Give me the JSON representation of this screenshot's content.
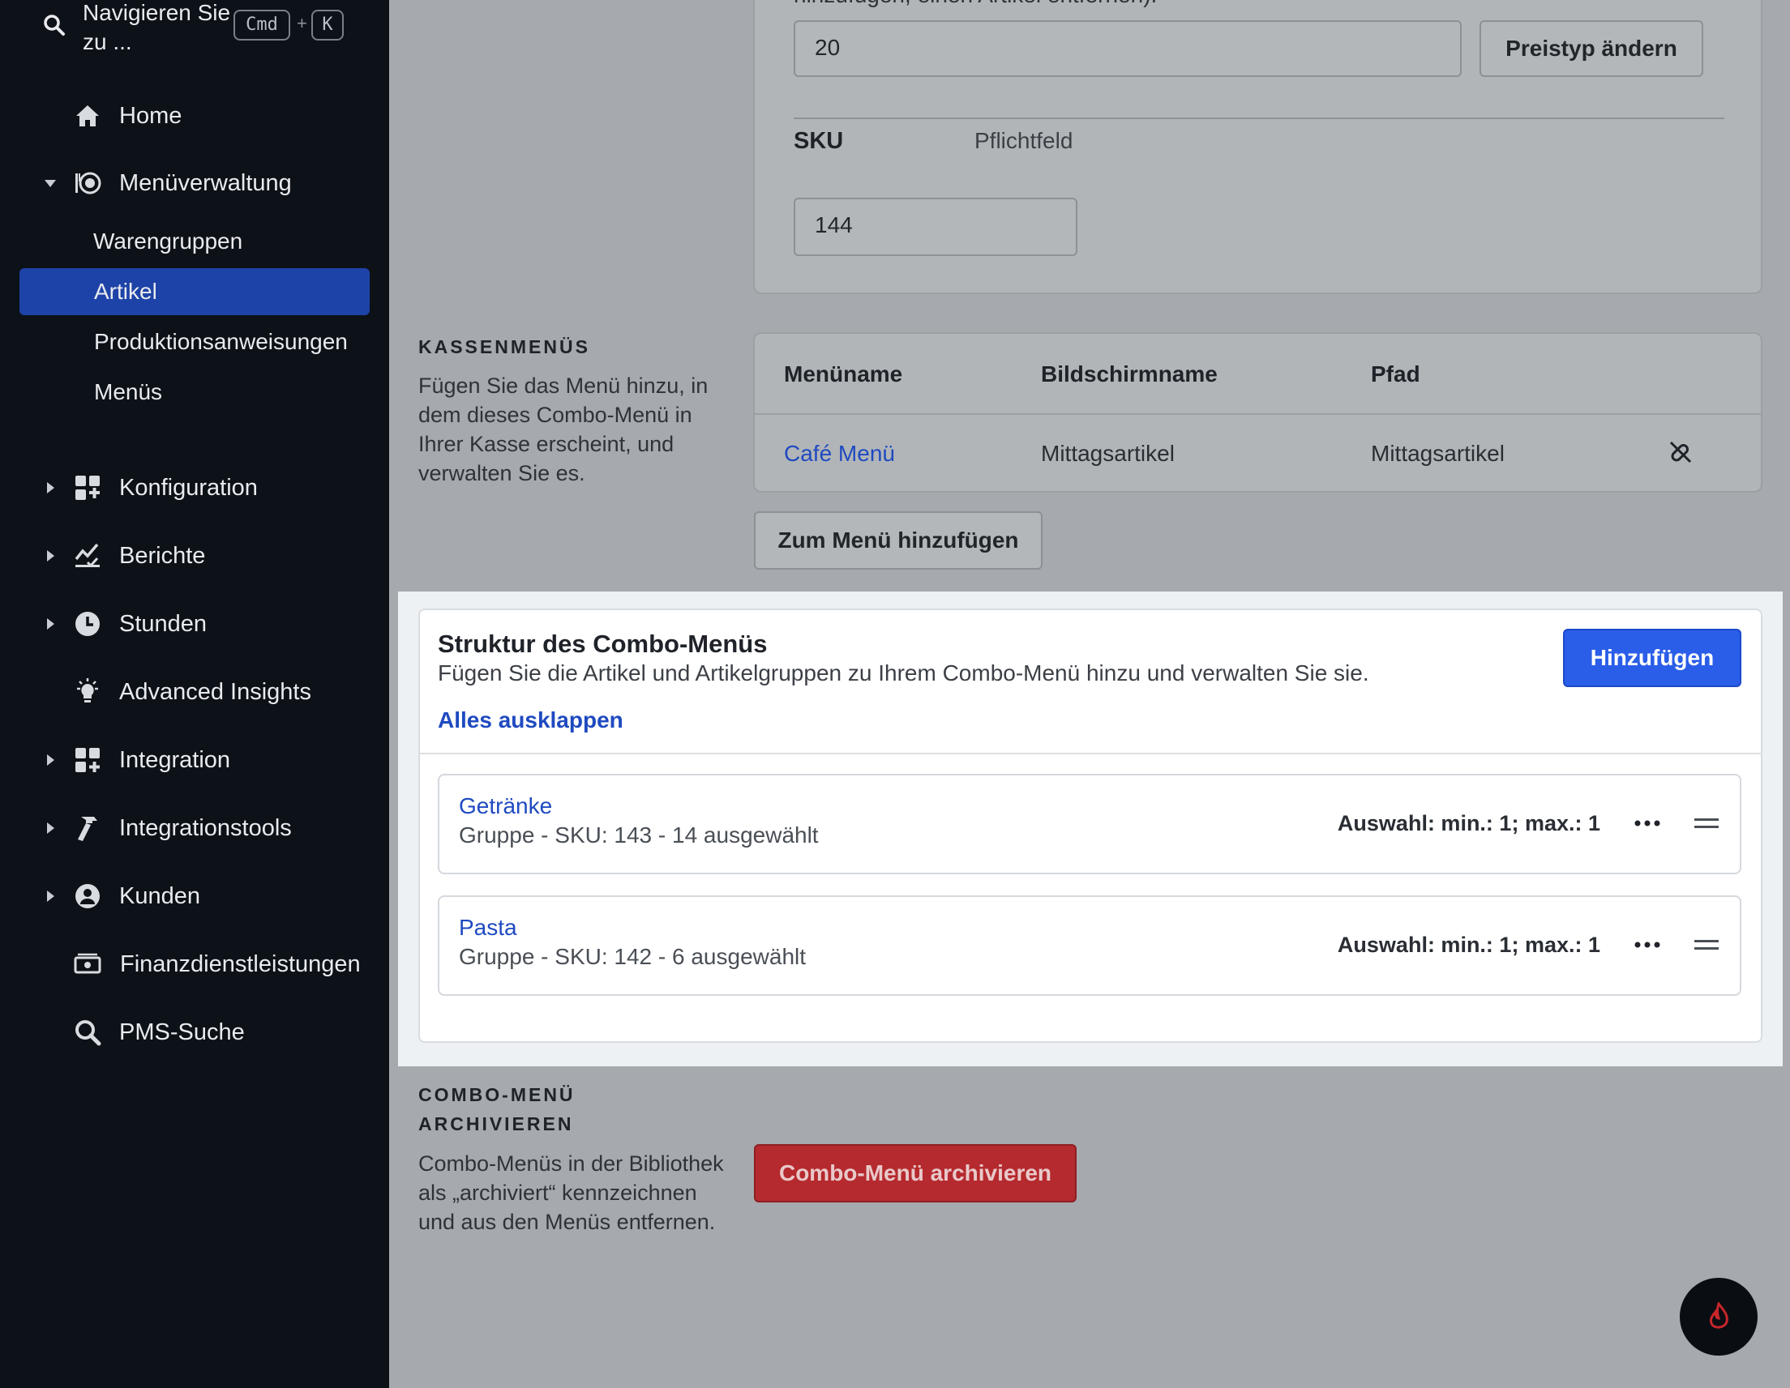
{
  "sidebar": {
    "search": {
      "text": "Navigieren Sie zu ...",
      "kbd_cmd": "Cmd",
      "kbd_plus": "+",
      "kbd_k": "K"
    },
    "items": [
      {
        "label": "Home",
        "icon": "home-icon"
      },
      {
        "label": "Menüverwaltung",
        "icon": "menu-management-icon",
        "expanded": true
      },
      {
        "label": "Konfiguration",
        "icon": "configuration-icon"
      },
      {
        "label": "Berichte",
        "icon": "reports-icon"
      },
      {
        "label": "Stunden",
        "icon": "clock-icon"
      },
      {
        "label": "Advanced Insights",
        "icon": "lightbulb-icon"
      },
      {
        "label": "Integration",
        "icon": "integration-icon"
      },
      {
        "label": "Integrationstools",
        "icon": "hammer-icon"
      },
      {
        "label": "Kunden",
        "icon": "customer-icon"
      },
      {
        "label": "Finanzdienstleistungen",
        "icon": "money-icon"
      },
      {
        "label": "PMS-Suche",
        "icon": "search-icon"
      }
    ],
    "subitems": [
      {
        "label": "Warengruppen"
      },
      {
        "label": "Artikel",
        "active": true
      },
      {
        "label": "Produktionsanweisungen"
      },
      {
        "label": "Menüs"
      }
    ]
  },
  "price": {
    "truncated_text": "hinzufügen, einen Artikel entfernen).",
    "value": "20",
    "change_button": "Preistyp ändern"
  },
  "sku": {
    "label": "SKU",
    "required": "Pflichtfeld",
    "value": "144"
  },
  "kassenmenus": {
    "heading": "KASSENMENÜS",
    "description": "Fügen Sie das Menü hinzu, in dem dieses Combo-Menü in Ihrer Kasse erscheint, und verwalten Sie es.",
    "columns": [
      "Menüname",
      "Bildschirmname",
      "Pfad"
    ],
    "rows": [
      {
        "menuname": "Café Menü",
        "bildschirmname": "Mittagsartikel",
        "pfad": "Mittagsartikel"
      }
    ],
    "add_button": "Zum Menü hinzufügen"
  },
  "combo": {
    "title": "Struktur des Combo-Menüs",
    "subtitle": "Fügen Sie die Artikel und Artikelgruppen zu Ihrem Combo-Menü hinzu und verwalten Sie sie.",
    "expand_all": "Alles ausklappen",
    "add_button": "Hinzufügen",
    "rows": [
      {
        "name": "Getränke",
        "sub": "Gruppe - SKU: 143 - 14 ausgewählt",
        "selection": "Auswahl: min.: 1; max.: 1"
      },
      {
        "name": "Pasta",
        "sub": "Gruppe - SKU: 142 - 6 ausgewählt",
        "selection": "Auswahl: min.: 1; max.: 1"
      }
    ]
  },
  "archive": {
    "heading_line1": "COMBO-MENÜ",
    "heading_line2": "ARCHIVIEREN",
    "description": "Combo-Menüs in der Bibliothek als „archiviert“ kennzeichnen und aus den Menüs entfernen.",
    "button": "Combo-Menü archivieren"
  },
  "colors": {
    "accent": "#1f4ac0",
    "primary_button": "#2a5ee8",
    "danger": "#b52a2e",
    "sidebar": "#0d1118",
    "active_nav": "#1e43a8"
  }
}
